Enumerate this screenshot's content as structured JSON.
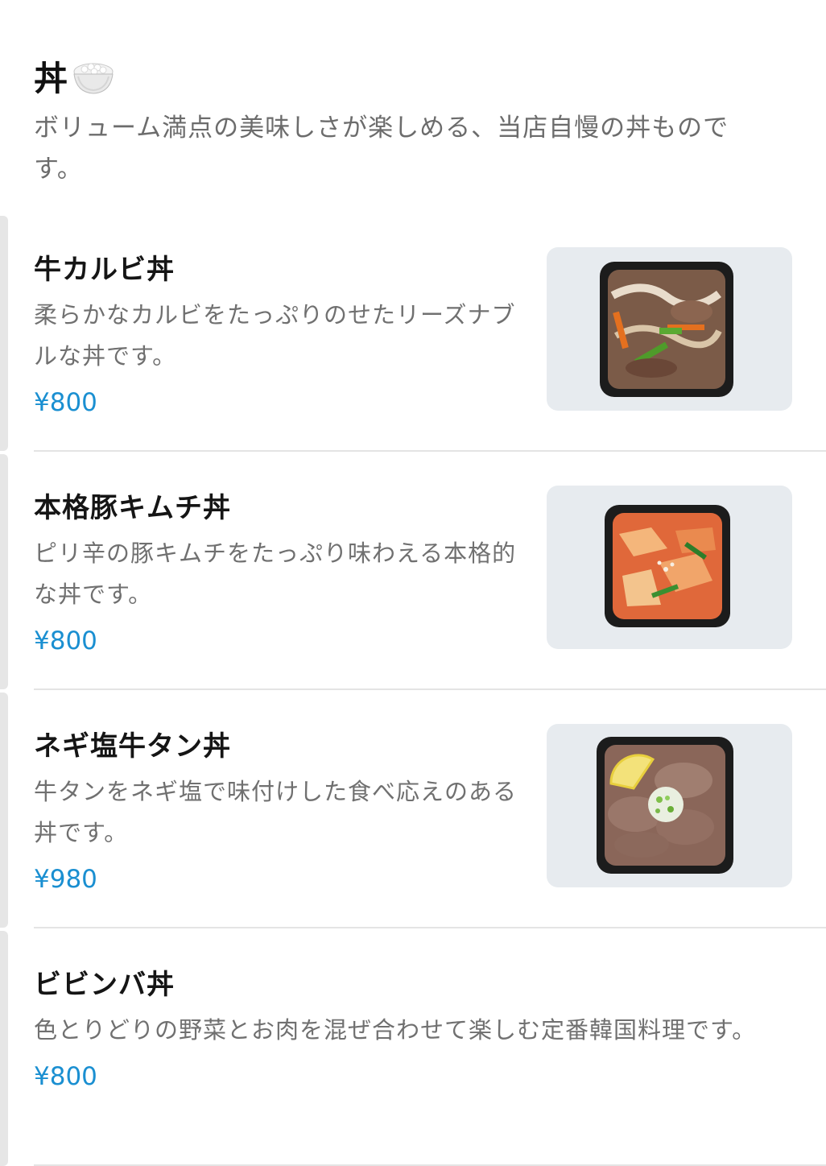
{
  "section": {
    "title": "丼",
    "icon": "rice-bowl-icon",
    "description": "ボリューム満点の美味しさが楽しめる、当店自慢の丼ものです。"
  },
  "items": [
    {
      "name": "牛カルビ丼",
      "description": "柔らかなカルビをたっぷりのせたリーズナブルな丼です。",
      "price": "¥800",
      "image": "beef-kalbi-bowl-photo"
    },
    {
      "name": "本格豚キムチ丼",
      "description": "ピリ辛の豚キムチをたっぷり味わえる本格的な丼です。",
      "price": "¥800",
      "image": "pork-kimchi-bowl-photo"
    },
    {
      "name": "ネギ塩牛タン丼",
      "description": "牛タンをネギ塩で味付けした食べ応えのある丼です。",
      "price": "¥980",
      "image": "negi-shio-beef-tongue-bowl-photo"
    },
    {
      "name": "ビビンバ丼",
      "description": "色とりどりの野菜とお肉を混ぜ合わせて楽しむ定番韓国料理です。",
      "price": "¥800"
    }
  ],
  "colors": {
    "price": "#1a8fd1",
    "text": "#1f1f1f",
    "muted": "#6c6c6c",
    "thumb_bg": "#e7ebef"
  }
}
